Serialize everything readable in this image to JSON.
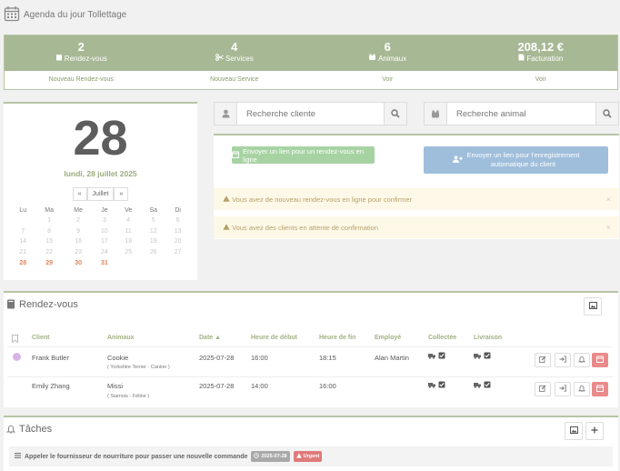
{
  "header": {
    "title": "Agenda du jour Tollettage",
    "icon": "calendar-icon"
  },
  "stats": [
    {
      "value": "2",
      "label": "Rendez-vous",
      "icon": "book-icon",
      "link": "Nouveau Rendez-vous"
    },
    {
      "value": "4",
      "label": "Services",
      "icon": "scissors-icon",
      "link": "Nouveau Service"
    },
    {
      "value": "6",
      "label": "Animaux",
      "icon": "paw-icon",
      "link": "Voir"
    },
    {
      "value": "208,12 €",
      "label": "Facturation",
      "icon": "file-icon",
      "link": "Voir"
    }
  ],
  "calendar": {
    "day": "28",
    "date_label": "lundi, 28 juillet 2025",
    "prev": "«",
    "month": "Juillet",
    "next": "»",
    "weekdays": [
      "Lu",
      "Ma",
      "Me",
      "Je",
      "Ve",
      "Sa",
      "Di"
    ],
    "weeks": [
      [
        "",
        "1",
        "2",
        "3",
        "4",
        "5",
        "6"
      ],
      [
        "7",
        "8",
        "9",
        "10",
        "11",
        "12",
        "13"
      ],
      [
        "14",
        "15",
        "16",
        "17",
        "18",
        "19",
        "20"
      ],
      [
        "21",
        "22",
        "23",
        "24",
        "25",
        "26",
        "27"
      ],
      [
        "28",
        "29",
        "30",
        "31",
        "",
        "",
        ""
      ]
    ],
    "highlighted": [
      "28",
      "29",
      "30",
      "31"
    ]
  },
  "search": {
    "client_placeholder": "Recherche cliente",
    "animal_placeholder": "Recherche animal"
  },
  "links": {
    "online_button": "Envoyer un lien pour un rendez-vous en ligne",
    "register_button_line1": "Envoyer un lien pour l'enregistrement",
    "register_button_line2": "automatique du client",
    "alert1": "Vous avez de nouveau rendez-vous en ligne pour confirmer",
    "alert2": "Vous avez des clients en attente de confirmation"
  },
  "appointments": {
    "title": "Rendez-vous",
    "columns": [
      "Client",
      "Animaux",
      "Date",
      "Heure de début",
      "Heure de fin",
      "Employé",
      "Collectée",
      "Livraison"
    ],
    "sort_indicator": "▲",
    "rows": [
      {
        "client": "Frank Butler",
        "animal": "Cookie",
        "animal_detail": "( Yorkshire Terrier - Canine )",
        "date": "2025-07-28",
        "start": "16:00",
        "end": "18:15",
        "employee": "Alan Martin",
        "dot_color": "#d9b3e6"
      },
      {
        "client": "Emily Zhang",
        "animal": "Missi",
        "animal_detail": "( Siamois - Féline )",
        "date": "2025-07-28",
        "start": "14:00",
        "end": "16:00",
        "employee": "",
        "dot_color": ""
      }
    ]
  },
  "tasks": {
    "title": "Tâches",
    "items": [
      {
        "text": "Appeler le fournisseur de nourriture pour passer une nouvelle commande",
        "date": "2025-07-28",
        "priority": "Urgent"
      }
    ]
  },
  "colors": {
    "accent": "#a7b894",
    "green_button": "#a7d3a3",
    "blue_button": "#9fbedc",
    "danger": "#ea8a8a",
    "highlight": "#e08555"
  }
}
